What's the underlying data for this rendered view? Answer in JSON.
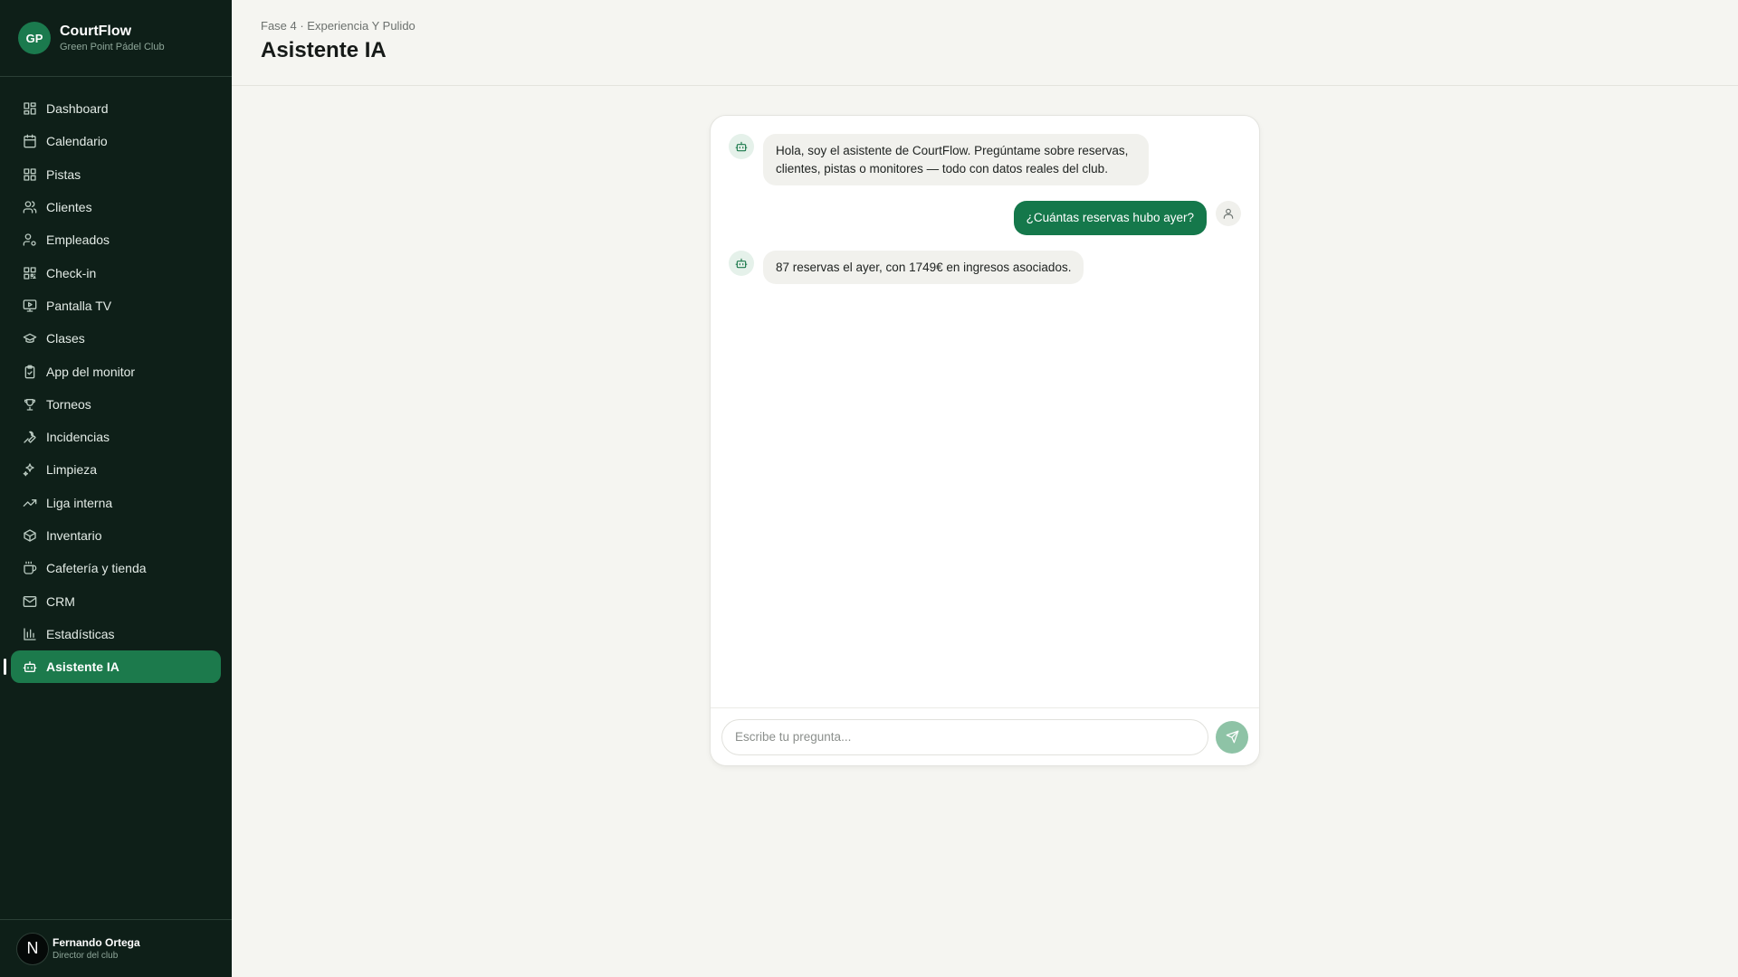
{
  "brand": {
    "initials": "GP",
    "name": "CourtFlow",
    "subtitle": "Green Point Pádel Club"
  },
  "sidebar": {
    "items": [
      {
        "label": "Dashboard",
        "icon": "dashboard-icon"
      },
      {
        "label": "Calendario",
        "icon": "calendar-icon"
      },
      {
        "label": "Pistas",
        "icon": "grid-icon"
      },
      {
        "label": "Clientes",
        "icon": "users-icon"
      },
      {
        "label": "Empleados",
        "icon": "user-cog-icon"
      },
      {
        "label": "Check-in",
        "icon": "qr-icon"
      },
      {
        "label": "Pantalla TV",
        "icon": "tv-icon"
      },
      {
        "label": "Clases",
        "icon": "graduation-cap-icon"
      },
      {
        "label": "App del monitor",
        "icon": "clipboard-icon"
      },
      {
        "label": "Torneos",
        "icon": "trophy-icon"
      },
      {
        "label": "Incidencias",
        "icon": "wrench-icon"
      },
      {
        "label": "Limpieza",
        "icon": "sparkles-icon"
      },
      {
        "label": "Liga interna",
        "icon": "trending-up-icon"
      },
      {
        "label": "Inventario",
        "icon": "package-icon"
      },
      {
        "label": "Cafetería y tienda",
        "icon": "coffee-icon"
      },
      {
        "label": "CRM",
        "icon": "mail-icon"
      },
      {
        "label": "Estadísticas",
        "icon": "bar-chart-icon"
      },
      {
        "label": "Asistente IA",
        "icon": "bot-icon",
        "active": true
      }
    ]
  },
  "user": {
    "initial": "N",
    "name": "Fernando Ortega",
    "role": "Director del club"
  },
  "header": {
    "breadcrumb": "Fase 4 · Experiencia Y Pulido",
    "title": "Asistente IA"
  },
  "chat": {
    "messages": [
      {
        "from": "bot",
        "text": "Hola, soy el asistente de CourtFlow. Pregúntame sobre reservas, clientes, pistas o monitores — todo con datos reales del club."
      },
      {
        "from": "user",
        "text": "¿Cuántas reservas hubo ayer?"
      },
      {
        "from": "bot",
        "text": "87 reservas el ayer, con 1749€ en ingresos asociados."
      }
    ],
    "input": {
      "placeholder": "Escribe tu pregunta...",
      "value": ""
    }
  },
  "colors": {
    "sidebar_bg": "#0e1f18",
    "accent": "#1c7a4c",
    "page_bg": "#f5f5f1"
  }
}
